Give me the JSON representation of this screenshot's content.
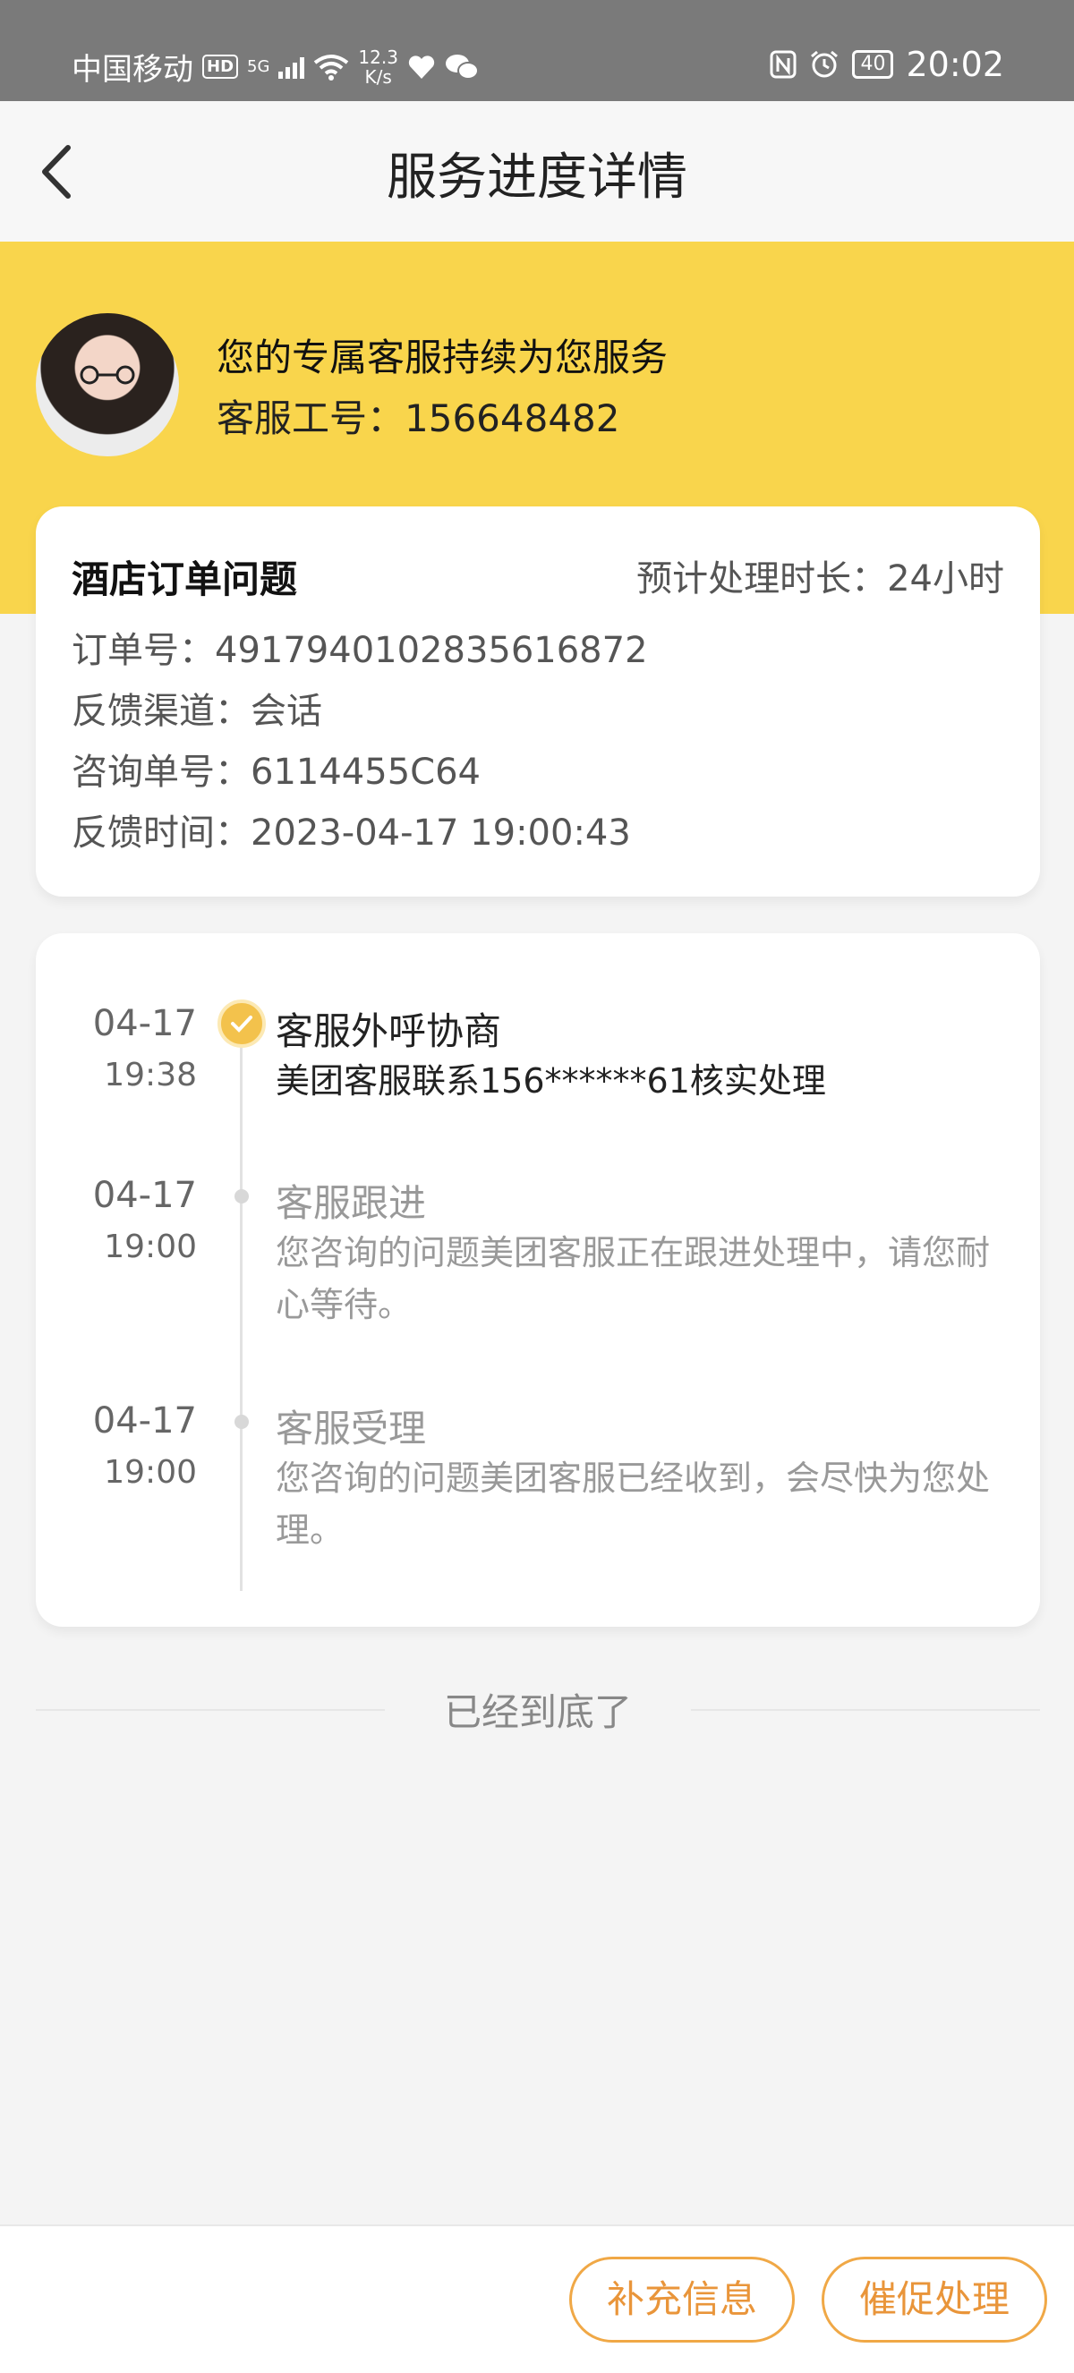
{
  "status_bar": {
    "carrier": "中国移动",
    "hd": "HD",
    "net": "5G",
    "speed_value": "12.3",
    "speed_unit": "K/s",
    "battery": "40",
    "time": "20:02"
  },
  "nav": {
    "title": "服务进度详情"
  },
  "agent": {
    "headline": "您的专属客服持续为您服务",
    "id_line": "客服工号：156648482"
  },
  "info_card": {
    "title": "酒店订单问题",
    "eta": "预计处理时长：24小时",
    "rows": [
      "订单号：4917940102835616872",
      "反馈渠道：会话",
      "咨询单号：6114455C64",
      "反馈时间：2023-04-17 19:00:43"
    ]
  },
  "timeline": [
    {
      "date": "04-17",
      "time": "19:38",
      "title": "客服外呼协商",
      "desc": "美团客服联系156******61核实处理",
      "active": true
    },
    {
      "date": "04-17",
      "time": "19:00",
      "title": "客服跟进",
      "desc": "您咨询的问题美团客服正在跟进处理中，请您耐心等待。",
      "active": false
    },
    {
      "date": "04-17",
      "time": "19:00",
      "title": "客服受理",
      "desc": "您咨询的问题美团客服已经收到，会尽快为您处理。",
      "active": false
    }
  ],
  "end_text": "已经到底了",
  "buttons": {
    "supplement": "补充信息",
    "urge": "催促处理"
  },
  "colors": {
    "accent_yellow": "#f9d54c",
    "button_orange": "#e9953a",
    "check_yellow": "#f3c24c"
  }
}
